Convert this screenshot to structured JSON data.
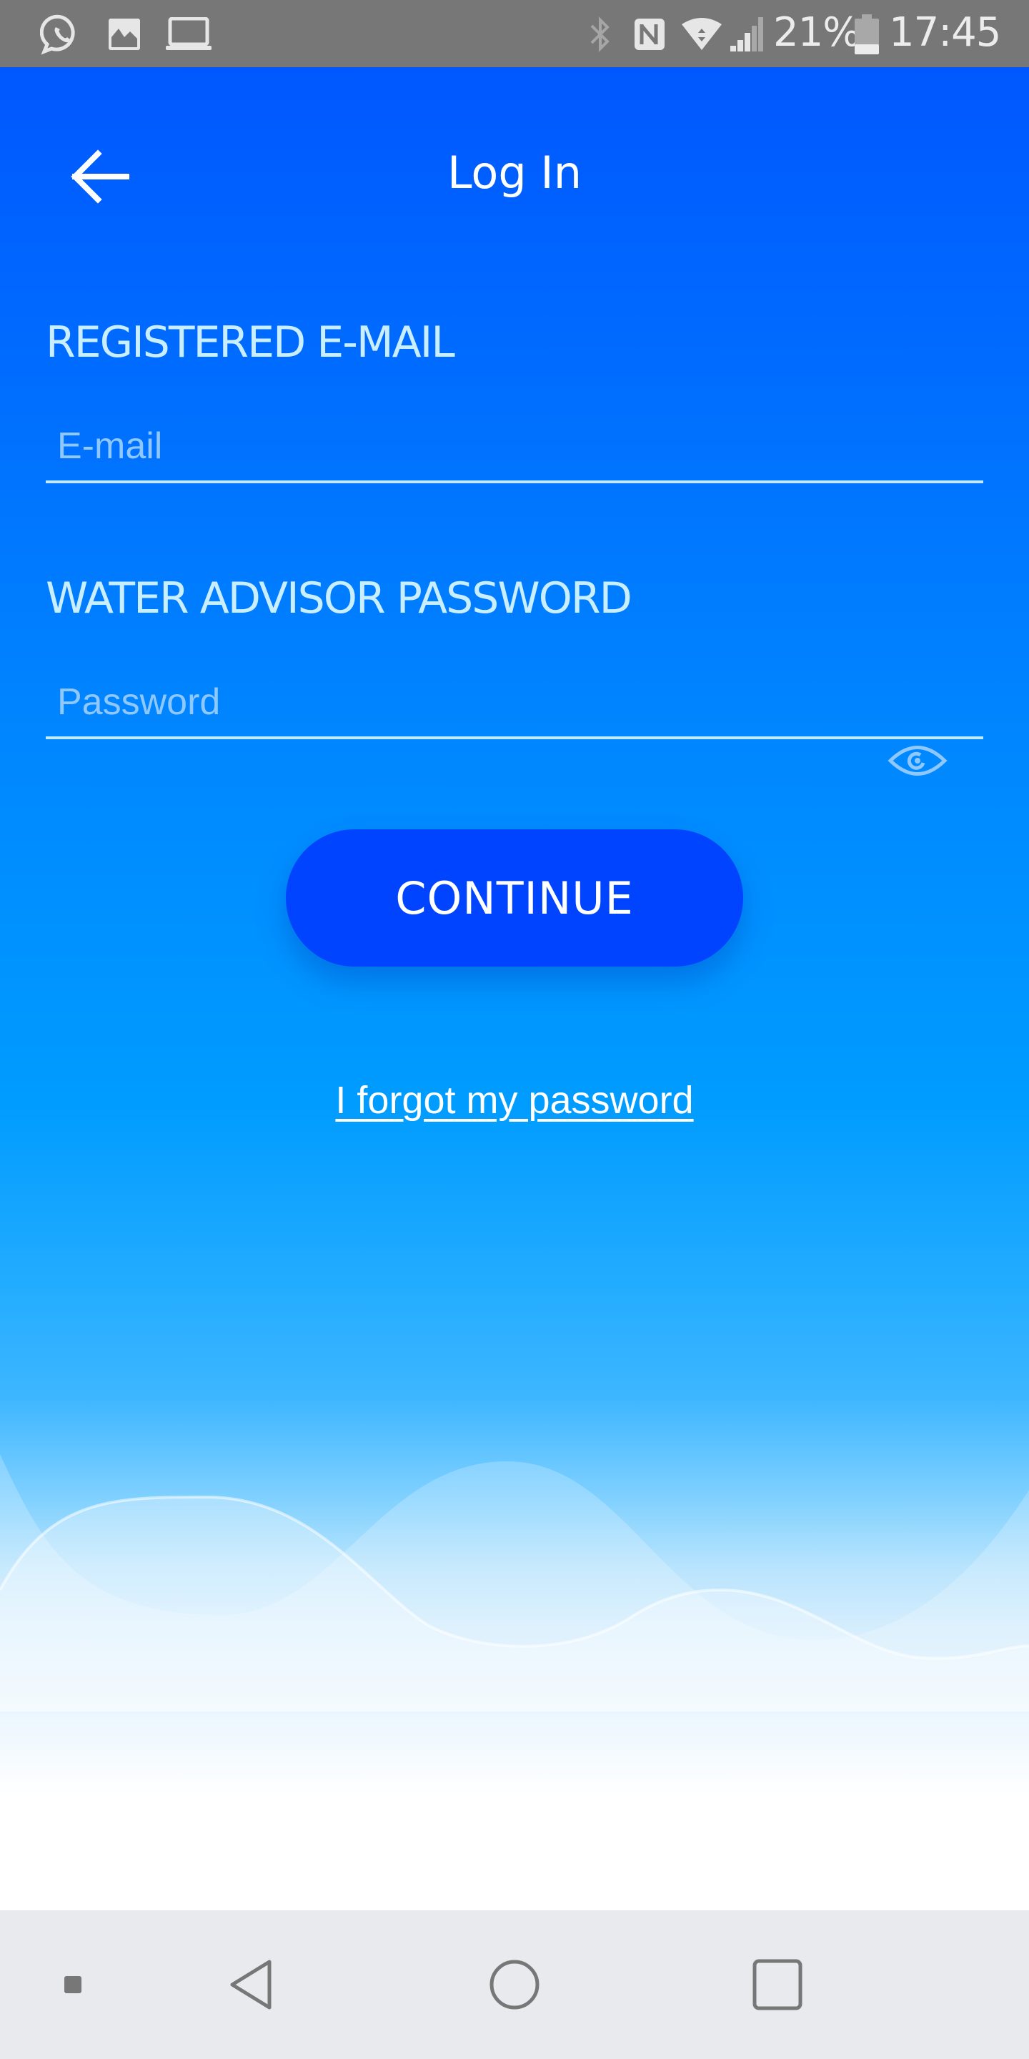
{
  "status_bar": {
    "left_icons": [
      "whatsapp-icon",
      "gallery-icon",
      "laptop-icon"
    ],
    "right_icons": [
      "bluetooth-icon",
      "nfc-icon",
      "wifi-icon",
      "signal-icon",
      "battery-icon"
    ],
    "battery_percent": "21%",
    "battery_level": 0.21,
    "time": "17:45"
  },
  "header": {
    "back_icon": "arrow-left-icon",
    "title": "Log In"
  },
  "form": {
    "email": {
      "label": "REGISTERED E-MAIL",
      "value": "",
      "placeholder": "E-mail"
    },
    "password": {
      "label": "WATER ADVISOR PASSWORD",
      "value": "",
      "placeholder": "Password",
      "toggle_icon": "eye-icon"
    },
    "continue_label": "CONTINUE",
    "forgot_link": "I forgot my password"
  },
  "colors": {
    "status_bar": "#777777",
    "gradient_top": "#0057FF",
    "gradient_mid": "#009CFF",
    "button": "#0044FF",
    "nav_bar": "#E8EAED"
  },
  "nav_bar": {
    "icons": [
      "indicator-dot-icon",
      "back-triangle-icon",
      "home-circle-icon",
      "recents-square-icon"
    ]
  }
}
